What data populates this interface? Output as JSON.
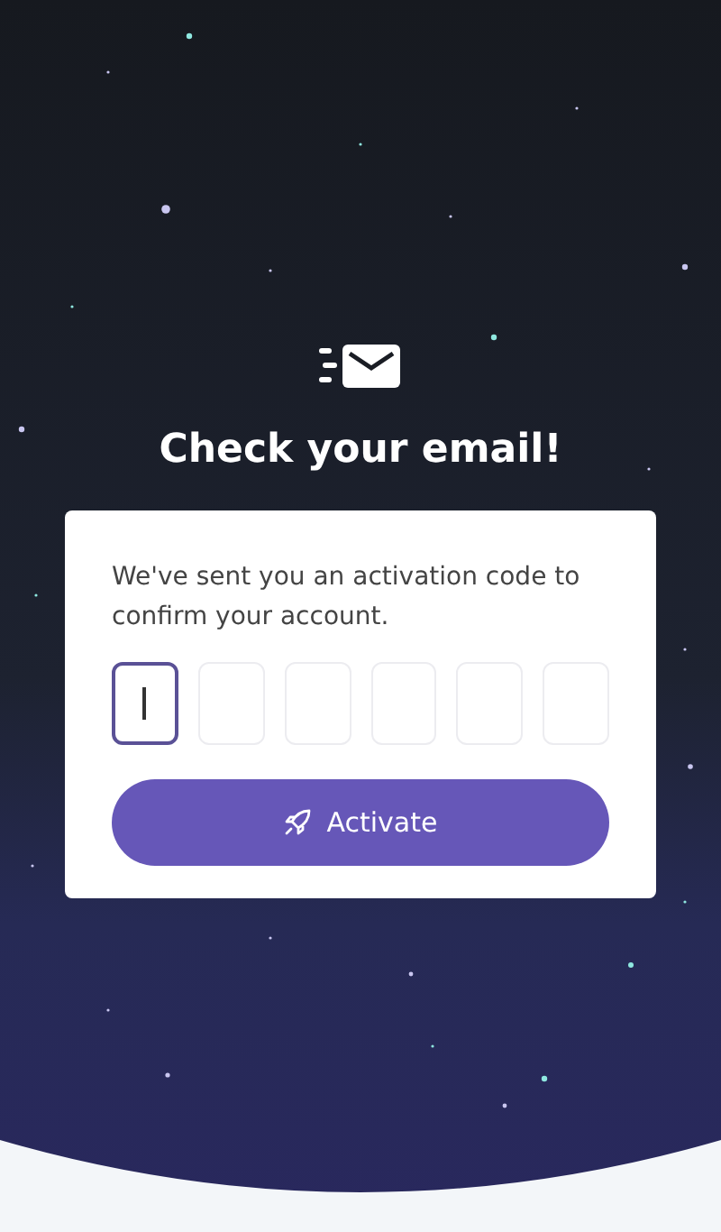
{
  "title": "Check your email!",
  "message": "We've sent you an activation code to confirm your account.",
  "code_boxes": [
    {
      "selected": true
    },
    {
      "selected": false
    },
    {
      "selected": false
    },
    {
      "selected": false
    },
    {
      "selected": false
    },
    {
      "selected": false
    }
  ],
  "button": {
    "label": "Activate"
  }
}
